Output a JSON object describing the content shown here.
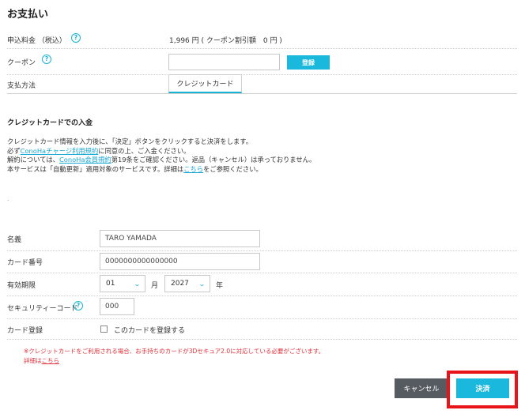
{
  "page": {
    "title": "お支払い"
  },
  "summary": {
    "fee_label": "申込料金 （税込）",
    "fee_value": "1,996 円 ( クーポン割引額　0 円 )",
    "coupon_label": "クーポン",
    "coupon_value": "",
    "coupon_button": "登録",
    "payment_label": "支払方法",
    "payment_tab": "クレジットカード"
  },
  "card_section": {
    "title": "クレジットカードでの入金",
    "desc": {
      "line1": "クレジットカード情報を入力後に、「決定」ボタンをクリックすると決済をします。",
      "line2_pre": "必ず",
      "line2_link": "ConoHaチャージ利用規約",
      "line2_post": "に同意の上、ご入金ください。",
      "line3_pre": "解約については、",
      "line3_link": "ConoHa会員規約",
      "line3_post": "第19条をご確認ください。返品（キャンセル）は承っておりません。",
      "line4_pre": "本サービスは「自動更新」適用対象のサービスです。詳細は",
      "line4_link": "こちら",
      "line4_post": "をご参照ください。"
    },
    "dot": "."
  },
  "form": {
    "name_label": "名義",
    "name_value": "TARO YAMADA",
    "number_label": "カード番号",
    "number_value": "0000000000000000",
    "expiry_label": "有効期限",
    "month_value": "01",
    "month_unit": "月",
    "year_value": "2027",
    "year_unit": "年",
    "security_label": "セキュリティーコード",
    "security_value": "000",
    "register_label": "カード登録",
    "register_checkbox_label": "このカードを登録する",
    "register_checked": false
  },
  "notice": {
    "line1": "※クレジットカードをご利用される場合、お手持ちのカードが3Dセキュア2.0に対応している必要がございます。",
    "line2_pre": "詳細は",
    "line2_link": "こちら"
  },
  "actions": {
    "cancel": "キャンセル",
    "submit": "決済"
  },
  "icons": {
    "help": "help-circle-icon",
    "chevron": "chevron-down-icon"
  },
  "colors": {
    "accent": "#1ab8dd",
    "warning": "#e0303a",
    "highlight": "#e8141a",
    "cancel_bg": "#555b61"
  }
}
